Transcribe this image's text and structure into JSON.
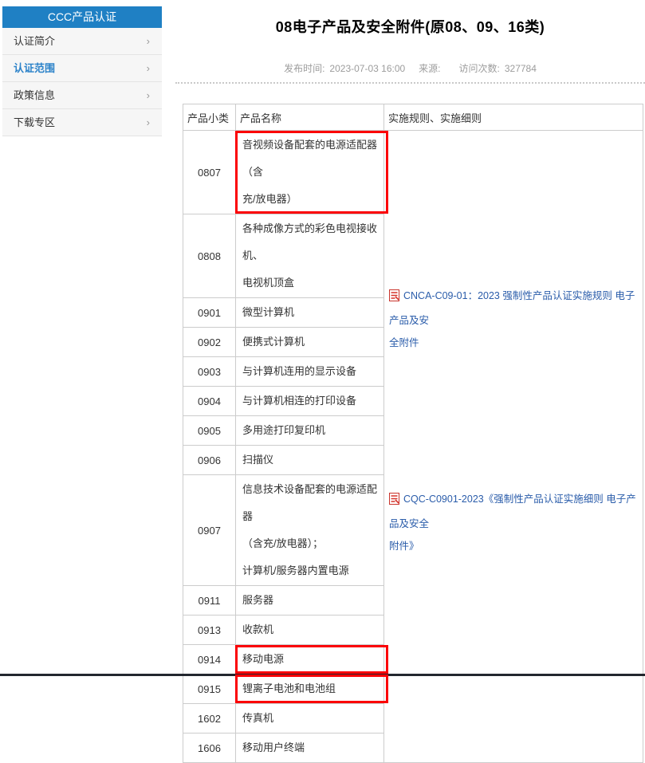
{
  "colors": {
    "sidebar_blue": "#1f80c4",
    "active_item_blue": "#2b82c9",
    "link_blue": "#2a5caa",
    "highlight_red": "#fb0006",
    "pdf_red": "#d6342c"
  },
  "sidebar": {
    "title": "CCC产品认证",
    "chevron": "›",
    "items": [
      {
        "label": "认证简介",
        "active": false
      },
      {
        "label": "认证范围",
        "active": true
      },
      {
        "label": "政策信息",
        "active": false
      },
      {
        "label": "下载专区",
        "active": false
      }
    ]
  },
  "header": {
    "title": "08电子产品及安全附件(原08、09、16类)",
    "publish_label": "发布时间:",
    "publish_time": "2023-07-03 16:00",
    "source_label": "来源:",
    "source_value": "",
    "visits_label": "访问次数:",
    "visits_value": "327784"
  },
  "table": {
    "columns": [
      "产品小类",
      "产品名称",
      "实施规则、实施细则"
    ],
    "rows": [
      {
        "code": "0807",
        "name": "音视频设备配套的电源适配器（含\n充/放电器）",
        "highlight": true
      },
      {
        "code": "0808",
        "name": "各种成像方式的彩色电视接收机、\n电视机顶盒",
        "highlight": false
      },
      {
        "code": "0901",
        "name": "微型计算机",
        "highlight": false
      },
      {
        "code": "0902",
        "name": "便携式计算机",
        "highlight": false
      },
      {
        "code": "0903",
        "name": "与计算机连用的显示设备",
        "highlight": false
      },
      {
        "code": "0904",
        "name": "与计算机相连的打印设备",
        "highlight": false
      },
      {
        "code": "0905",
        "name": "多用途打印复印机",
        "highlight": false
      },
      {
        "code": "0906",
        "name": "扫描仪",
        "highlight": false
      },
      {
        "code": "0907",
        "name": "信息技术设备配套的电源适配器\n（含充/放电器）；\n计算机/服务器内置电源",
        "highlight": false
      },
      {
        "code": "0911",
        "name": "服务器",
        "highlight": false
      },
      {
        "code": "0913",
        "name": "收款机",
        "highlight": false
      },
      {
        "code": "0914",
        "name": "移动电源",
        "highlight": true
      },
      {
        "code": "0915",
        "name": "锂离子电池和电池组",
        "highlight": true
      },
      {
        "code": "1602",
        "name": "传真机",
        "highlight": false
      },
      {
        "code": "1606",
        "name": "移动用户终端",
        "highlight": false
      }
    ],
    "documents": [
      {
        "label": "CNCA-C09-01：2023 强制性产品认证实施规则 电子产品及安\n全附件"
      },
      {
        "label": "CQC-C0901-2023《强制性产品认证实施细则 电子产品及安全\n附件》"
      }
    ]
  }
}
